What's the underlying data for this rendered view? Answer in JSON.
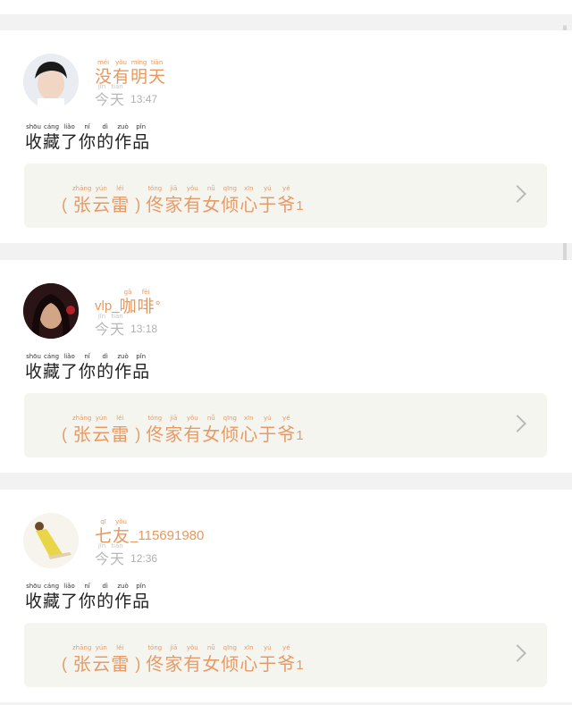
{
  "notifications": [
    {
      "user_name_pinyin": [
        "méi",
        "yǒu",
        "míng",
        "tiān"
      ],
      "user_name_chars": [
        "没",
        "有",
        "明",
        "天"
      ],
      "user_name_suffix": "",
      "date_pinyin": [
        "jīn",
        "tiān"
      ],
      "date_chars": [
        "今",
        "天"
      ],
      "time": "13:47",
      "action_pinyin": [
        "shōu",
        "cáng",
        "liǎo",
        "nǐ",
        "dì",
        "zuò",
        "pǐn"
      ],
      "action_chars": [
        "收",
        "藏",
        "了",
        "你",
        "的",
        "作",
        "品"
      ],
      "work_open": "(",
      "work_author_pinyin": [
        "zhāng",
        "yún",
        "léi"
      ],
      "work_author_chars": [
        "张",
        "云",
        "雷"
      ],
      "work_close": ")",
      "work_title_pinyin": [
        "tóng",
        "jiā",
        "yǒu",
        "nǚ",
        "qīng",
        "xīn",
        "yú",
        "yé"
      ],
      "work_title_chars": [
        "佟",
        "家",
        "有",
        "女",
        "倾",
        "心",
        "于",
        "爷"
      ],
      "work_suffix": "1"
    },
    {
      "user_name_prefix": "vlp_",
      "user_name_pinyin": [
        "gā",
        "fēi"
      ],
      "user_name_chars": [
        "咖",
        "啡"
      ],
      "user_name_suffix": "°",
      "date_pinyin": [
        "jīn",
        "tiān"
      ],
      "date_chars": [
        "今",
        "天"
      ],
      "time": "13:18",
      "action_pinyin": [
        "shōu",
        "cáng",
        "liǎo",
        "nǐ",
        "dì",
        "zuò",
        "pǐn"
      ],
      "action_chars": [
        "收",
        "藏",
        "了",
        "你",
        "的",
        "作",
        "品"
      ],
      "work_open": "(",
      "work_author_pinyin": [
        "zhāng",
        "yún",
        "léi"
      ],
      "work_author_chars": [
        "张",
        "云",
        "雷"
      ],
      "work_close": ")",
      "work_title_pinyin": [
        "tóng",
        "jiā",
        "yǒu",
        "nǚ",
        "qīng",
        "xīn",
        "yú",
        "yé"
      ],
      "work_title_chars": [
        "佟",
        "家",
        "有",
        "女",
        "倾",
        "心",
        "于",
        "爷"
      ],
      "work_suffix": "1"
    },
    {
      "user_name_pinyin": [
        "qī",
        "yǒu"
      ],
      "user_name_chars": [
        "七",
        "友"
      ],
      "user_name_suffix": "_115691980",
      "date_pinyin": [
        "jīn",
        "tiān"
      ],
      "date_chars": [
        "今",
        "天"
      ],
      "time": "12:36",
      "action_pinyin": [
        "shōu",
        "cáng",
        "liǎo",
        "nǐ",
        "dì",
        "zuò",
        "pǐn"
      ],
      "action_chars": [
        "收",
        "藏",
        "了",
        "你",
        "的",
        "作",
        "品"
      ],
      "work_open": "(",
      "work_author_pinyin": [
        "zhāng",
        "yún",
        "léi"
      ],
      "work_author_chars": [
        "张",
        "云",
        "雷"
      ],
      "work_close": ")",
      "work_title_pinyin": [
        "tóng",
        "jiā",
        "yǒu",
        "nǚ",
        "qīng",
        "xīn",
        "yú",
        "yé"
      ],
      "work_title_chars": [
        "佟",
        "家",
        "有",
        "女",
        "倾",
        "心",
        "于",
        "爷"
      ],
      "work_suffix": "1"
    }
  ],
  "colors": {
    "accent": "#e8985c",
    "card_bg": "#ffffff",
    "work_bg": "#f5f5f0",
    "page_bg": "#f3f2f2"
  },
  "icons": {
    "chevron": "chevron-right-icon",
    "avatar": "avatar"
  }
}
